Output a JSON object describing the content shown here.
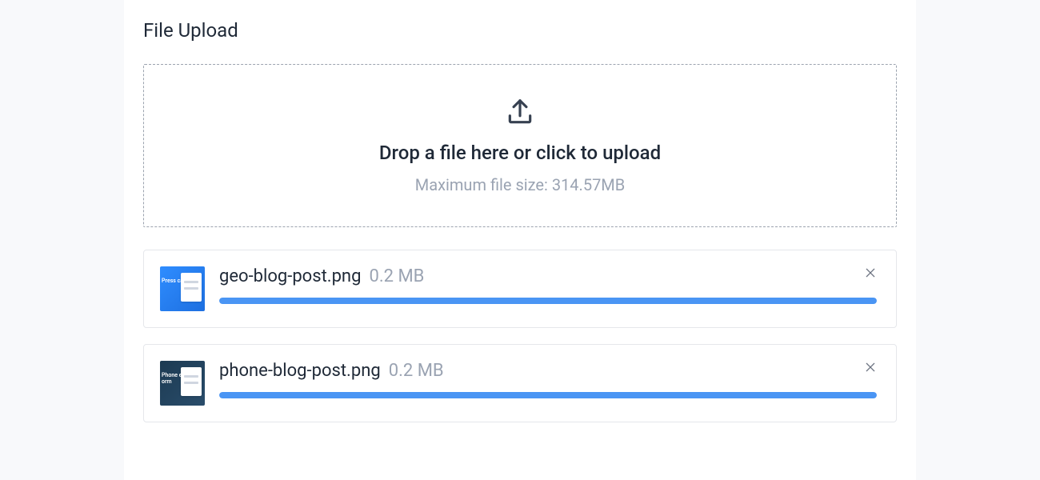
{
  "title": "File Upload",
  "dropzone": {
    "main_text": "Drop a file here or click to upload",
    "sub_text": "Maximum file size: 314.57MB"
  },
  "files": [
    {
      "name": "geo-blog-post.png",
      "size": "0.2 MB",
      "progress": 100,
      "thumb_label": "Press\ncation"
    },
    {
      "name": "phone-blog-post.png",
      "size": "0.2 MB",
      "progress": 100,
      "thumb_label": "Phone\ner Field\norm"
    }
  ]
}
